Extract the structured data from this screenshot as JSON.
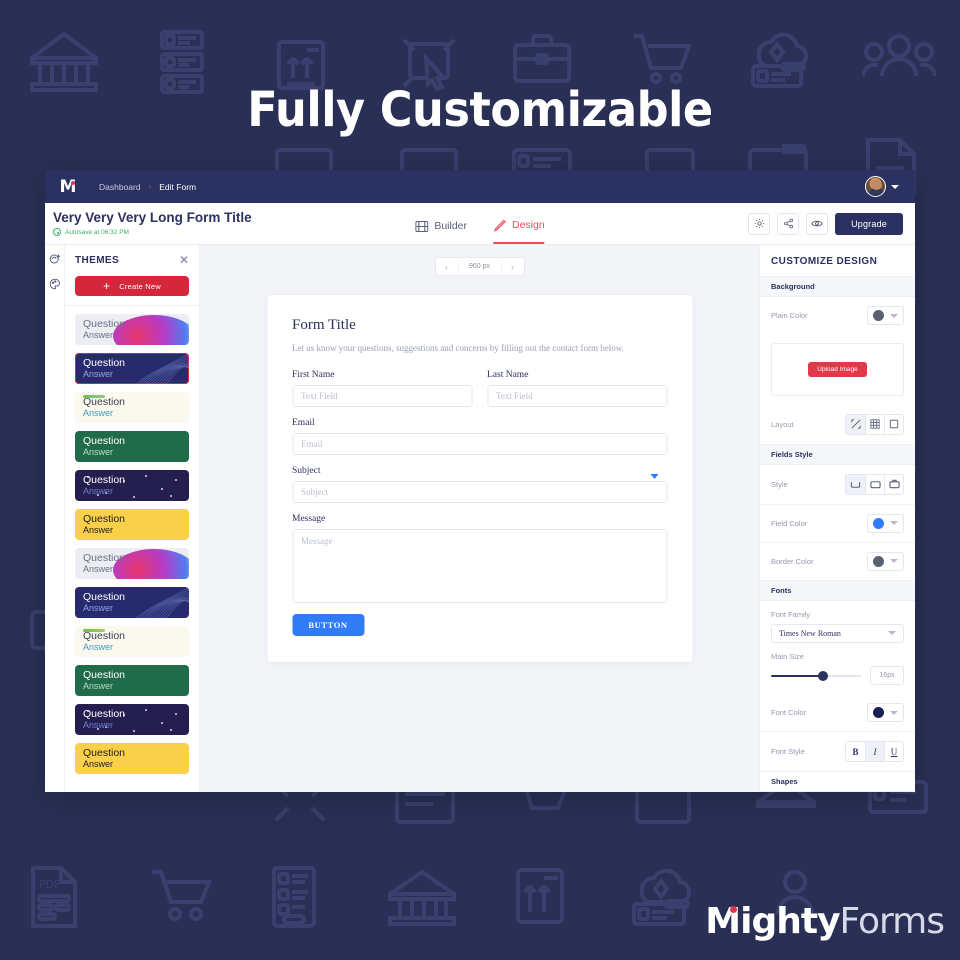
{
  "hero": {
    "title": "Fully Customizable"
  },
  "brand": {
    "bold": "Mighty",
    "light": "Forms"
  },
  "topnav": {
    "logo": "M",
    "breadcrumbs": [
      "Dashboard",
      "Edit Form"
    ],
    "separator": "›",
    "avatar_alt": "user-avatar"
  },
  "header": {
    "form_title": "Very Very Very Long Form Title",
    "autosave": "Autosave at 06:32 PM",
    "tabs": [
      {
        "label": "Builder",
        "icon": "builder-icon",
        "active": false
      },
      {
        "label": "Design",
        "icon": "pencil-icon",
        "active": true
      }
    ],
    "actions": [
      {
        "name": "settings-button",
        "icon": "gear-icon"
      },
      {
        "name": "share-button",
        "icon": "share-icon"
      },
      {
        "name": "preview-button",
        "icon": "eye-icon"
      }
    ],
    "upgrade_label": "Upgrade"
  },
  "rail": {
    "icons": [
      "theme-add-icon",
      "palette-icon"
    ]
  },
  "themes": {
    "title": "THEMES",
    "close": "✕",
    "create_new": "Create New",
    "plus": "+",
    "cards": [
      {
        "question": "Question",
        "answer": "Answer",
        "bg": "#eceef3",
        "text": "#6b7186",
        "answer_color": "#6b7186",
        "decor": "blob",
        "selected": false
      },
      {
        "question": "Question",
        "answer": "Answer",
        "bg": "#272b6e",
        "text": "#ffffff",
        "answer_color": "#8fa4e8",
        "decor": "swirl",
        "selected": true
      },
      {
        "question": "Question",
        "answer": "Answer",
        "bg": "#fbf8ee",
        "text": "#3a3f55",
        "answer_color": "#3c9ac2",
        "decor": "greenline",
        "selected": false
      },
      {
        "question": "Question",
        "answer": "Answer",
        "bg": "#1f6b4a",
        "text": "#ffffff",
        "answer_color": "#bcdccb",
        "decor": "none",
        "selected": false
      },
      {
        "question": "Question",
        "answer": "Answer",
        "bg": "#241f4e",
        "text": "#ffffff",
        "answer_color": "#6f7fd2",
        "decor": "stars",
        "selected": false
      },
      {
        "question": "Question",
        "answer": "Answer",
        "bg": "#fad04a",
        "text": "#1c1c1c",
        "answer_color": "#1c1c1c",
        "decor": "none",
        "selected": false
      },
      {
        "question": "Question",
        "answer": "Answer",
        "bg": "#eceef3",
        "text": "#6b7186",
        "answer_color": "#6b7186",
        "decor": "blob",
        "selected": false
      },
      {
        "question": "Question",
        "answer": "Answer",
        "bg": "#272b6e",
        "text": "#ffffff",
        "answer_color": "#8fa4e8",
        "decor": "swirl",
        "selected": false
      },
      {
        "question": "Question",
        "answer": "Answer",
        "bg": "#fbf8ee",
        "text": "#3a3f55",
        "answer_color": "#3c9ac2",
        "decor": "greenline",
        "selected": false
      },
      {
        "question": "Question",
        "answer": "Answer",
        "bg": "#1f6b4a",
        "text": "#ffffff",
        "answer_color": "#bcdccb",
        "decor": "none",
        "selected": false
      },
      {
        "question": "Question",
        "answer": "Answer",
        "bg": "#241f4e",
        "text": "#ffffff",
        "answer_color": "#6f7fd2",
        "decor": "stars",
        "selected": false
      },
      {
        "question": "Question",
        "answer": "Answer",
        "bg": "#fad04a",
        "text": "#1c1c1c",
        "answer_color": "#1c1c1c",
        "decor": "none",
        "selected": false
      }
    ]
  },
  "canvas": {
    "width_control": {
      "prev": "‹",
      "value": "960 px",
      "next": "›"
    },
    "form": {
      "title": "Form Title",
      "description": "Let us know your questions, suggestions and concerns by filling out the contact form below.",
      "fields": [
        {
          "label": "First Name",
          "placeholder": "Text Field",
          "type": "text"
        },
        {
          "label": "Last Name",
          "placeholder": "Text Field",
          "type": "text"
        },
        {
          "label": "Email",
          "placeholder": "Email",
          "type": "text"
        },
        {
          "label": "Subject",
          "placeholder": "Subject",
          "type": "select"
        },
        {
          "label": "Message",
          "placeholder": "Message",
          "type": "textarea"
        }
      ],
      "button_label": "BUTTON"
    }
  },
  "right_panel": {
    "title": "CUSTOMIZE DESIGN",
    "sections": {
      "background": {
        "heading": "Background",
        "plain_color_label": "Plain Color",
        "plain_color_value": "#596273",
        "upload_label": "Upload Image",
        "layout_label": "Layout",
        "layout_options": [
          "fit-icon",
          "tile-icon",
          "stretch-icon"
        ],
        "layout_selected": 0
      },
      "fields_style": {
        "heading": "Fields Style",
        "style_label": "Style",
        "style_options": [
          "underline-icon",
          "box-icon",
          "box-label-icon"
        ],
        "style_selected": 0,
        "field_color_label": "Field Color",
        "field_color_value": "#2f7cf6",
        "border_color_label": "Border Color",
        "border_color_value": "#596273"
      },
      "fonts": {
        "heading": "Fonts",
        "font_family_label": "Font Family",
        "font_family_value": "Times New Roman",
        "main_size_label": "Main Size",
        "main_size_value": "16px",
        "font_color_label": "Font Color",
        "font_color_value": "#1b2050",
        "font_style_label": "Font Style",
        "font_style_options": [
          "B",
          "I",
          "U"
        ],
        "font_style_selected": 1
      },
      "shapes": {
        "heading": "Shapes"
      }
    }
  }
}
